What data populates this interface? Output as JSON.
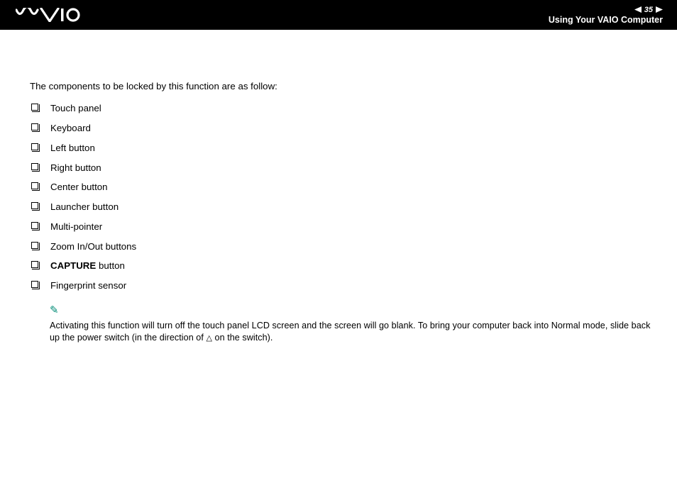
{
  "header": {
    "page_number": "35",
    "section_title": "Using Your VAIO Computer"
  },
  "content": {
    "intro": "The components to be locked by this function are as follow:",
    "bullets": [
      {
        "text": "Touch panel",
        "bold": false
      },
      {
        "text": "Keyboard",
        "bold": false
      },
      {
        "text": "Left button",
        "bold": false
      },
      {
        "text": "Right button",
        "bold": false
      },
      {
        "text": "Center button",
        "bold": false
      },
      {
        "text": "Launcher button",
        "bold": false
      },
      {
        "text": "Multi-pointer",
        "bold": false
      },
      {
        "text": "Zoom In/Out buttons",
        "bold": false
      },
      {
        "text_prefix": "CAPTURE",
        "text_suffix": " button",
        "bold": true
      },
      {
        "text": "Fingerprint sensor",
        "bold": false
      }
    ],
    "note_prefix": "Activating this function will turn off the touch panel LCD screen and the screen will go blank. To bring your computer back into Normal mode, slide back up the power switch (in the direction of ",
    "note_triangle": "△",
    "note_suffix": " on the switch)."
  }
}
